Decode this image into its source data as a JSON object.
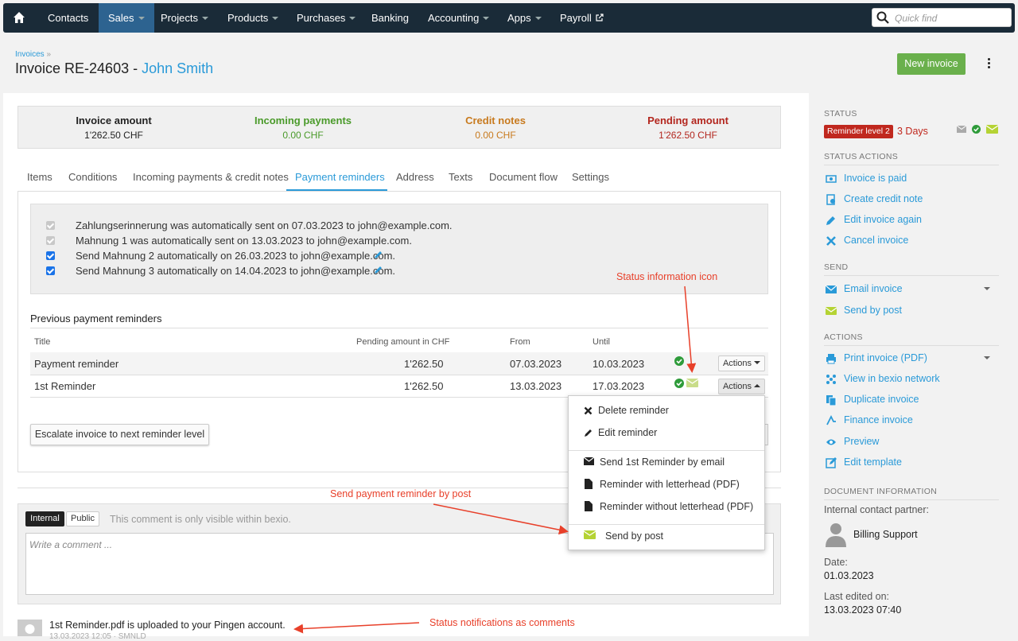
{
  "nav": {
    "items": [
      {
        "label": "Contacts"
      },
      {
        "label": "Sales"
      },
      {
        "label": "Projects"
      },
      {
        "label": "Products"
      },
      {
        "label": "Purchases"
      },
      {
        "label": "Banking"
      },
      {
        "label": "Accounting"
      },
      {
        "label": "Apps"
      },
      {
        "label": "Payroll"
      }
    ],
    "quick_find_placeholder": "Quick find"
  },
  "header": {
    "breadcrumb": "Invoices",
    "breadcrumb_sep": "»",
    "title": "Invoice RE-24603 -",
    "contact": "John Smith",
    "new_invoice": "New invoice"
  },
  "summary": [
    {
      "title": "Invoice amount",
      "value": "1'262.50 CHF",
      "color": "#222222"
    },
    {
      "title": "Incoming payments",
      "value": "0.00 CHF",
      "color": "#4a9a2a"
    },
    {
      "title": "Credit notes",
      "value": "0.00 CHF",
      "color": "#c87a1e"
    },
    {
      "title": "Pending amount",
      "value": "1'262.50 CHF",
      "color": "#b3261e"
    }
  ],
  "tabs": [
    "Items",
    "Conditions",
    "Incoming payments & credit notes",
    "Payment reminders",
    "Address",
    "Texts",
    "Document flow",
    "Settings"
  ],
  "reminder_log": [
    {
      "text": "Zahlungserinnerung was automatically sent on 07.03.2023 to john@example.com."
    },
    {
      "text": "Mahnung 1 was automatically sent on 13.03.2023 to john@example.com."
    },
    {
      "text": "Send Mahnung 2 automatically on 26.03.2023 to john@example.com."
    },
    {
      "text": "Send Mahnung 3 automatically on 14.04.2023 to john@example.com."
    }
  ],
  "previous": {
    "heading": "Previous payment reminders",
    "columns": {
      "title": "Title",
      "pending": "Pending amount in CHF",
      "from": "From",
      "until": "Until"
    },
    "rows": [
      {
        "title": "Payment reminder",
        "pending": "1'262.50",
        "from": "07.03.2023",
        "until": "10.03.2023",
        "actions": "Actions"
      },
      {
        "title": "1st Reminder",
        "pending": "1'262.50",
        "from": "13.03.2023",
        "until": "17.03.2023",
        "actions": "Actions"
      }
    ],
    "escalate": "Escalate invoice to next reminder level"
  },
  "dropdown": {
    "delete": "Delete reminder",
    "edit": "Edit reminder",
    "send_email": "Send 1st Reminder by email",
    "with_letterhead": "Reminder with letterhead (PDF)",
    "without_letterhead": "Reminder without letterhead (PDF)",
    "send_post": "Send by post"
  },
  "annotations": {
    "status_icon": "Status information icon",
    "send_post": "Send payment reminder by post",
    "notifications": "Status notifications as comments"
  },
  "comment": {
    "internal": "Internal",
    "public": "Public",
    "hint": "This comment is only visible within bexio.",
    "placeholder": "Write a comment ...",
    "entry_text": "1st Reminder.pdf is uploaded to your Pingen account.",
    "entry_meta": "13.03.2023 12:05 · SMNLD"
  },
  "sidebar": {
    "status_h": "STATUS",
    "status_badge": "Reminder level 2",
    "status_days": "3 Days",
    "status_actions_h": "STATUS ACTIONS",
    "status_actions": [
      "Invoice is paid",
      "Create credit note",
      "Edit invoice again",
      "Cancel invoice"
    ],
    "send_h": "SEND",
    "send": [
      "Email invoice",
      "Send by post"
    ],
    "actions_h": "ACTIONS",
    "actions": [
      "Print invoice (PDF)",
      "View in bexio network",
      "Duplicate invoice",
      "Finance invoice",
      "Preview",
      "Edit template"
    ],
    "docinfo_h": "DOCUMENT INFORMATION",
    "contact_partner_label": "Internal contact partner:",
    "contact_partner": "Billing Support",
    "date_label": "Date:",
    "date": "01.03.2023",
    "edited_label": "Last edited on:",
    "edited": "13.03.2023 07:40"
  },
  "colors": {
    "navbar": "#1a2b38",
    "accent": "#2a9ad8",
    "green_button": "#6ab04c",
    "badge_red": "#c0281e",
    "annotation": "#e8402a",
    "post_icon": "#b5d334"
  }
}
